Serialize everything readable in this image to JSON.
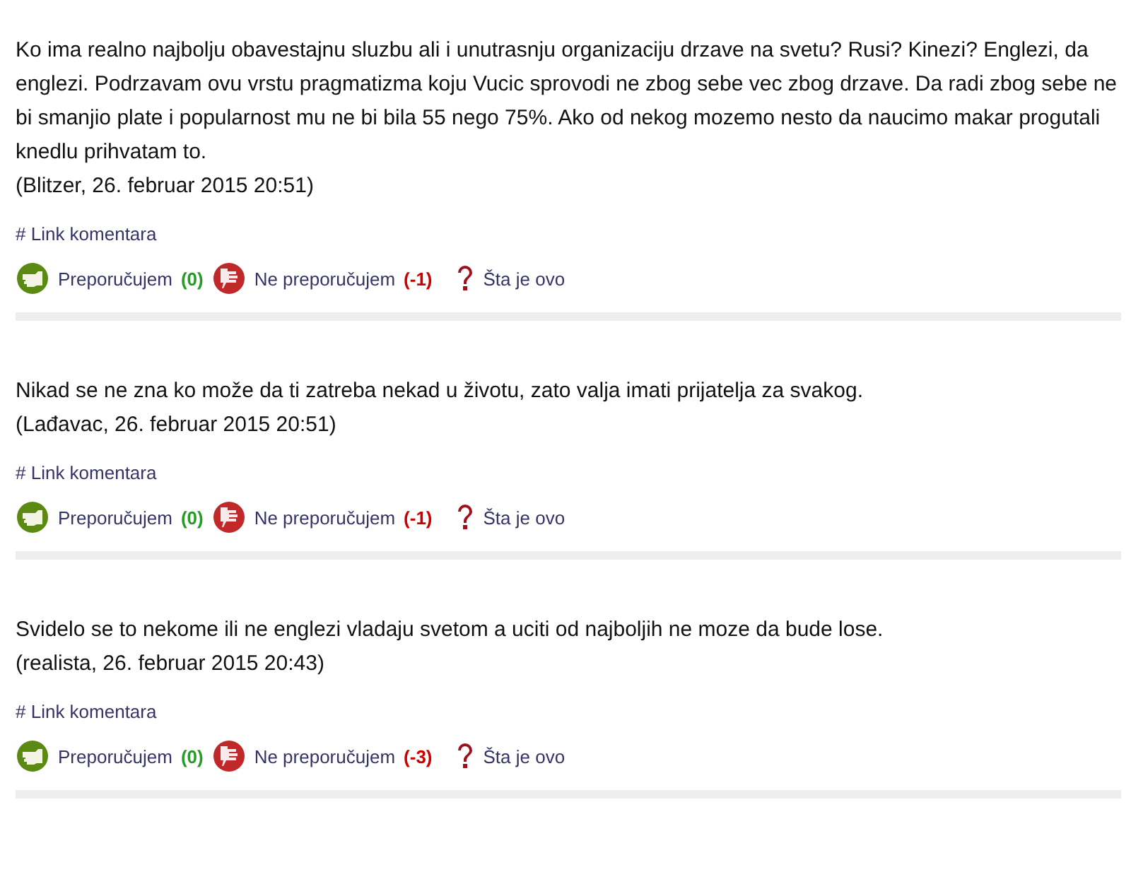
{
  "comments": [
    {
      "text": "Ko ima realno najbolju obavestajnu sluzbu ali i unutrasnju organizaciju drzave na svetu? Rusi? Kinezi? Englezi, da englezi. Podrzavam ovu vrstu pragmatizma koju Vucic sprovodi ne zbog sebe vec zbog drzave. Da radi zbog sebe ne bi smanjio plate i popularnost mu ne bi bila 55 nego 75%. Ako od nekog mozemo nesto da naucimo makar progutali knedlu prihvatam to.",
      "byline": "(Blitzer, 26. februar 2015 20:51)",
      "link": "# Link komentara",
      "recommend": "Preporučujem",
      "recommend_count": "(0)",
      "not_recommend": "Ne preporučujem",
      "not_recommend_count": "(-1)",
      "help": "Šta je ovo"
    },
    {
      "text": "Nikad se ne zna ko može da ti zatreba nekad u životu, zato valja imati prijatelja za svakog.",
      "byline": "(Lađavac, 26. februar 2015 20:51)",
      "link": "# Link komentara",
      "recommend": "Preporučujem",
      "recommend_count": "(0)",
      "not_recommend": "Ne preporučujem",
      "not_recommend_count": "(-1)",
      "help": "Šta je ovo"
    },
    {
      "text": "Svidelo se to nekome ili ne englezi vladaju svetom a uciti od najboljih ne moze da bude lose.",
      "byline": "(realista, 26. februar 2015 20:43)",
      "link": "# Link komentara",
      "recommend": "Preporučujem",
      "recommend_count": "(0)",
      "not_recommend": "Ne preporučujem",
      "not_recommend_count": "(-3)",
      "help": "Šta je ovo"
    }
  ]
}
